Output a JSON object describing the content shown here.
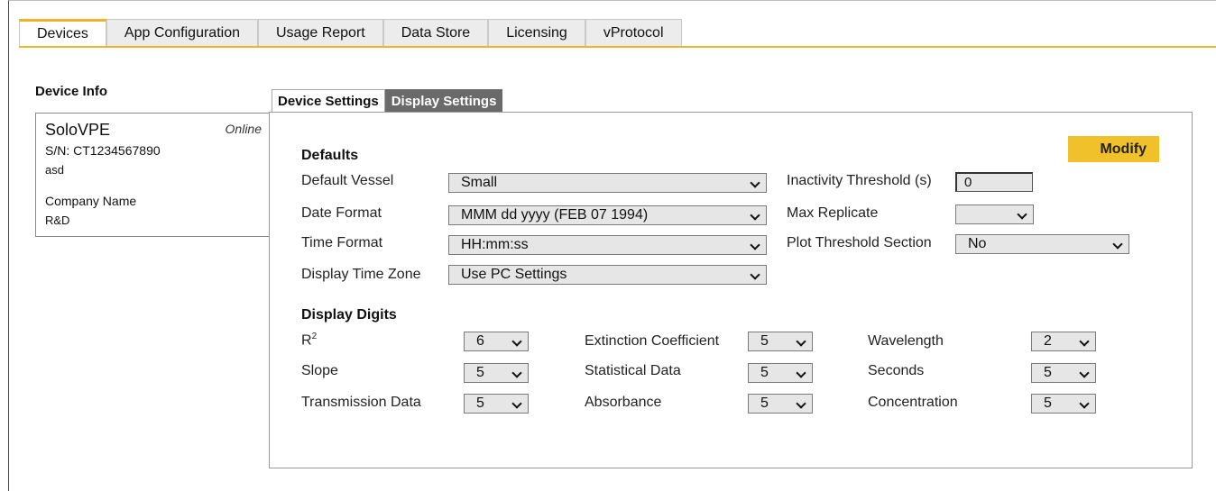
{
  "top_tabs": [
    {
      "label": "Devices"
    },
    {
      "label": "App Configuration"
    },
    {
      "label": "Usage Report"
    },
    {
      "label": "Data Store"
    },
    {
      "label": "Licensing"
    },
    {
      "label": "vProtocol"
    }
  ],
  "device_info": {
    "title": "Device Info",
    "name": "SoloVPE",
    "status": "Online",
    "serial": "S/N: CT1234567890",
    "note": "asd",
    "company_label": "Company Name",
    "company_value": "R&D"
  },
  "settings_tabs": {
    "device_settings": "Device Settings",
    "display_settings": "Display Settings"
  },
  "modify_label": "Modify",
  "defaults": {
    "title": "Defaults",
    "default_vessel": {
      "label": "Default Vessel",
      "value": "Small"
    },
    "date_format": {
      "label": "Date Format",
      "value": "MMM dd yyyy (FEB 07 1994)"
    },
    "time_format": {
      "label": "Time Format",
      "value": "HH:mm:ss"
    },
    "display_time_zone": {
      "label": "Display Time Zone",
      "value": "Use PC Settings"
    },
    "inactivity_threshold": {
      "label": "Inactivity Threshold (s)",
      "value": "0"
    },
    "max_replicate": {
      "label": "Max Replicate",
      "value": ""
    },
    "plot_threshold_section": {
      "label": "Plot Threshold Section",
      "value": "No"
    }
  },
  "display_digits": {
    "title": "Display Digits",
    "r2": {
      "label": "R",
      "sup": "2",
      "value": "6"
    },
    "slope": {
      "label": "Slope",
      "value": "5"
    },
    "transmission_data": {
      "label": "Transmission Data",
      "value": "5"
    },
    "extinction_coefficient": {
      "label": "Extinction Coefficient",
      "value": "5"
    },
    "statistical_data": {
      "label": "Statistical Data",
      "value": "5"
    },
    "absorbance": {
      "label": "Absorbance",
      "value": "5"
    },
    "wavelength": {
      "label": "Wavelength",
      "value": "2"
    },
    "seconds": {
      "label": "Seconds",
      "value": "5"
    },
    "concentration": {
      "label": "Concentration",
      "value": "5"
    }
  },
  "colors": {
    "accent": "#f0b323",
    "modify_button": "#f0c12a",
    "active_settings_tab": "#6a6a6a",
    "input_background": "#e6e6e6"
  }
}
